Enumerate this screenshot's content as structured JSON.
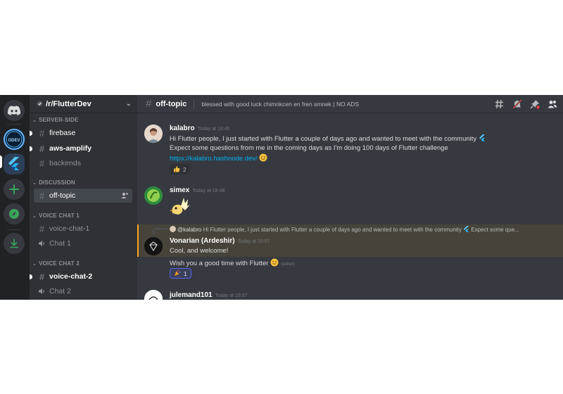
{
  "server": {
    "name": "/r/FlutterDev",
    "rail_icons": [
      "discord-home-icon",
      "odev-server-icon",
      "flutter-server-icon",
      "add-server-icon",
      "explore-icon",
      "download-icon"
    ]
  },
  "sidebar": {
    "categories": [
      {
        "label": "SERVER-SIDE"
      },
      {
        "label": "DISCUSSION"
      },
      {
        "label": "VOICE CHAT 1"
      },
      {
        "label": "VOICE CHAT 2"
      }
    ],
    "channels": {
      "firebase": "firebase",
      "aws": "aws-amplify",
      "backends": "backends",
      "offtopic": "off-topic",
      "voice1": "voice-chat-1",
      "chat1": "Chat 1",
      "voice2": "voice-chat-2",
      "chat2": "Chat 2"
    }
  },
  "topbar": {
    "channel": "off-topic",
    "topic": "blessed with good luck chimnkcen en fren smnek | NO ADS"
  },
  "messages": {
    "m1": {
      "author": "kalabro",
      "time": "Today at 18:45",
      "line1": "Hi Flutter people, I just started with Flutter a couple of days ago and wanted to meet with the community",
      "line2": "Expect some questions from me in the coming days as I'm doing 100 days of Flutter challenge",
      "link": "https://kalabro.hashnode.dev/",
      "reaction_count": "2"
    },
    "m2": {
      "author": "simex",
      "time": "Today at 18:48"
    },
    "m3": {
      "reply_author": "@kalabro",
      "reply_text": "Hi Flutter people, I just started with Flutter a couple of days ago and wanted to meet with the community",
      "reply_tail": "Expect some que...",
      "author": "Vonarian (Ardeshir)",
      "time": "Today at 19:57",
      "line1": "Cool, and welcome!",
      "line2": "Wish you a good time with Flutter",
      "edited": "(edited)",
      "reaction_count": "1"
    },
    "m4": {
      "author": "julemand101",
      "time": "Today at 19:57"
    }
  },
  "colors": {
    "background": "#36393f",
    "sidebar": "#2f3136",
    "rail": "#202225",
    "link": "#00b0f4",
    "mention_highlight": "#48433a"
  }
}
